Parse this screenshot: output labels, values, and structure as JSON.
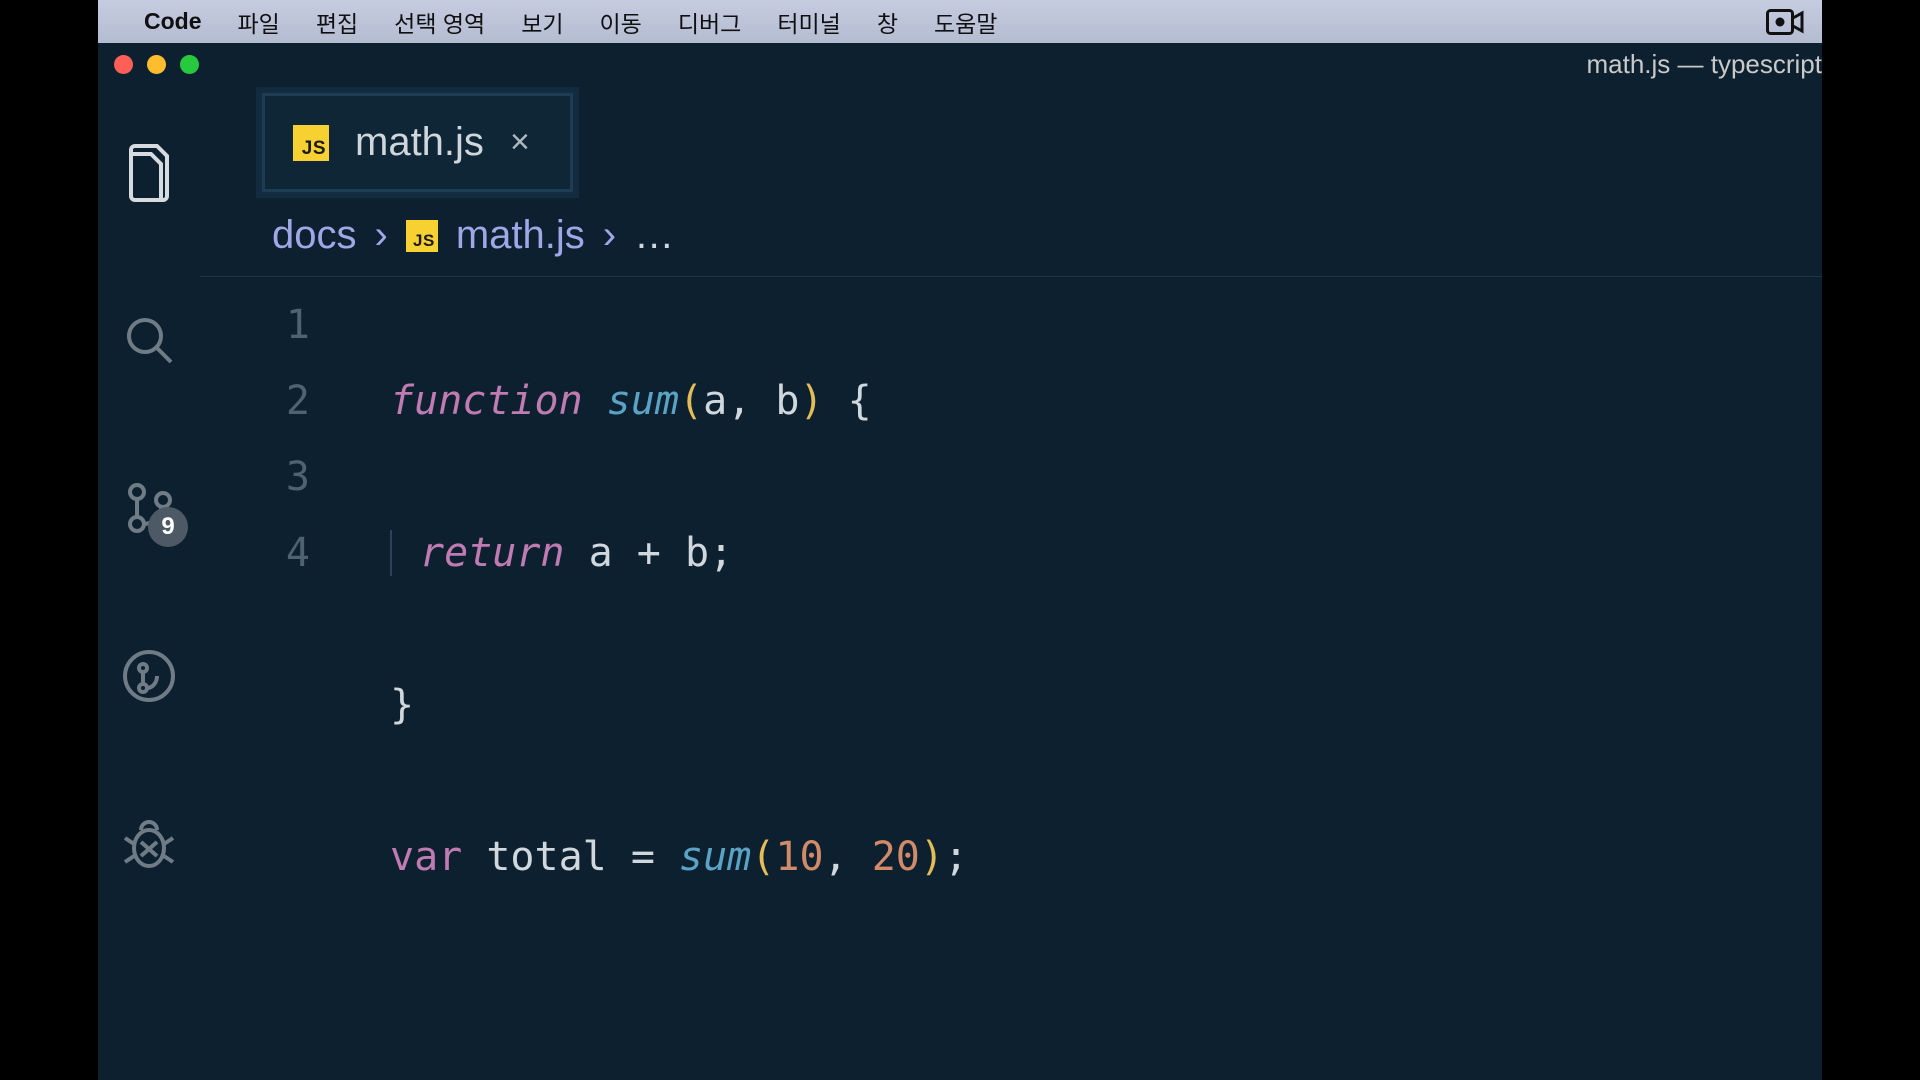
{
  "menubar": {
    "app": "Code",
    "items": [
      "파일",
      "편집",
      "선택 영역",
      "보기",
      "이동",
      "디버그",
      "터미널",
      "창",
      "도움말"
    ]
  },
  "window": {
    "title": "math.js — typescript"
  },
  "activitybar": {
    "badge_scm": "9"
  },
  "tab": {
    "icon_label": "JS",
    "filename": "math.js",
    "close": "×"
  },
  "breadcrumb": {
    "folder": "docs",
    "chev1": "›",
    "icon_label": "JS",
    "file": "math.js",
    "chev2": "›",
    "ellipsis": "…"
  },
  "editor": {
    "lines": [
      "1",
      "2",
      "3",
      "4"
    ],
    "code": {
      "l1": {
        "kw": "function",
        "fn": "sum",
        "open": "(",
        "p1": "a",
        "c1": ", ",
        "p2": "b",
        "close": ")",
        "sp": " ",
        "brace": "{"
      },
      "l2": {
        "kw": "return",
        "a": "a",
        "op": " + ",
        "b": "b",
        "semi": ";"
      },
      "l3": {
        "brace": "}"
      },
      "l4": {
        "kw": "var",
        "name": " total ",
        "eq": "=",
        "sp": " ",
        "fn": "sum",
        "open": "(",
        "n1": "10",
        "c1": ", ",
        "n2": "20",
        "close": ")",
        "semi": ";"
      }
    }
  }
}
